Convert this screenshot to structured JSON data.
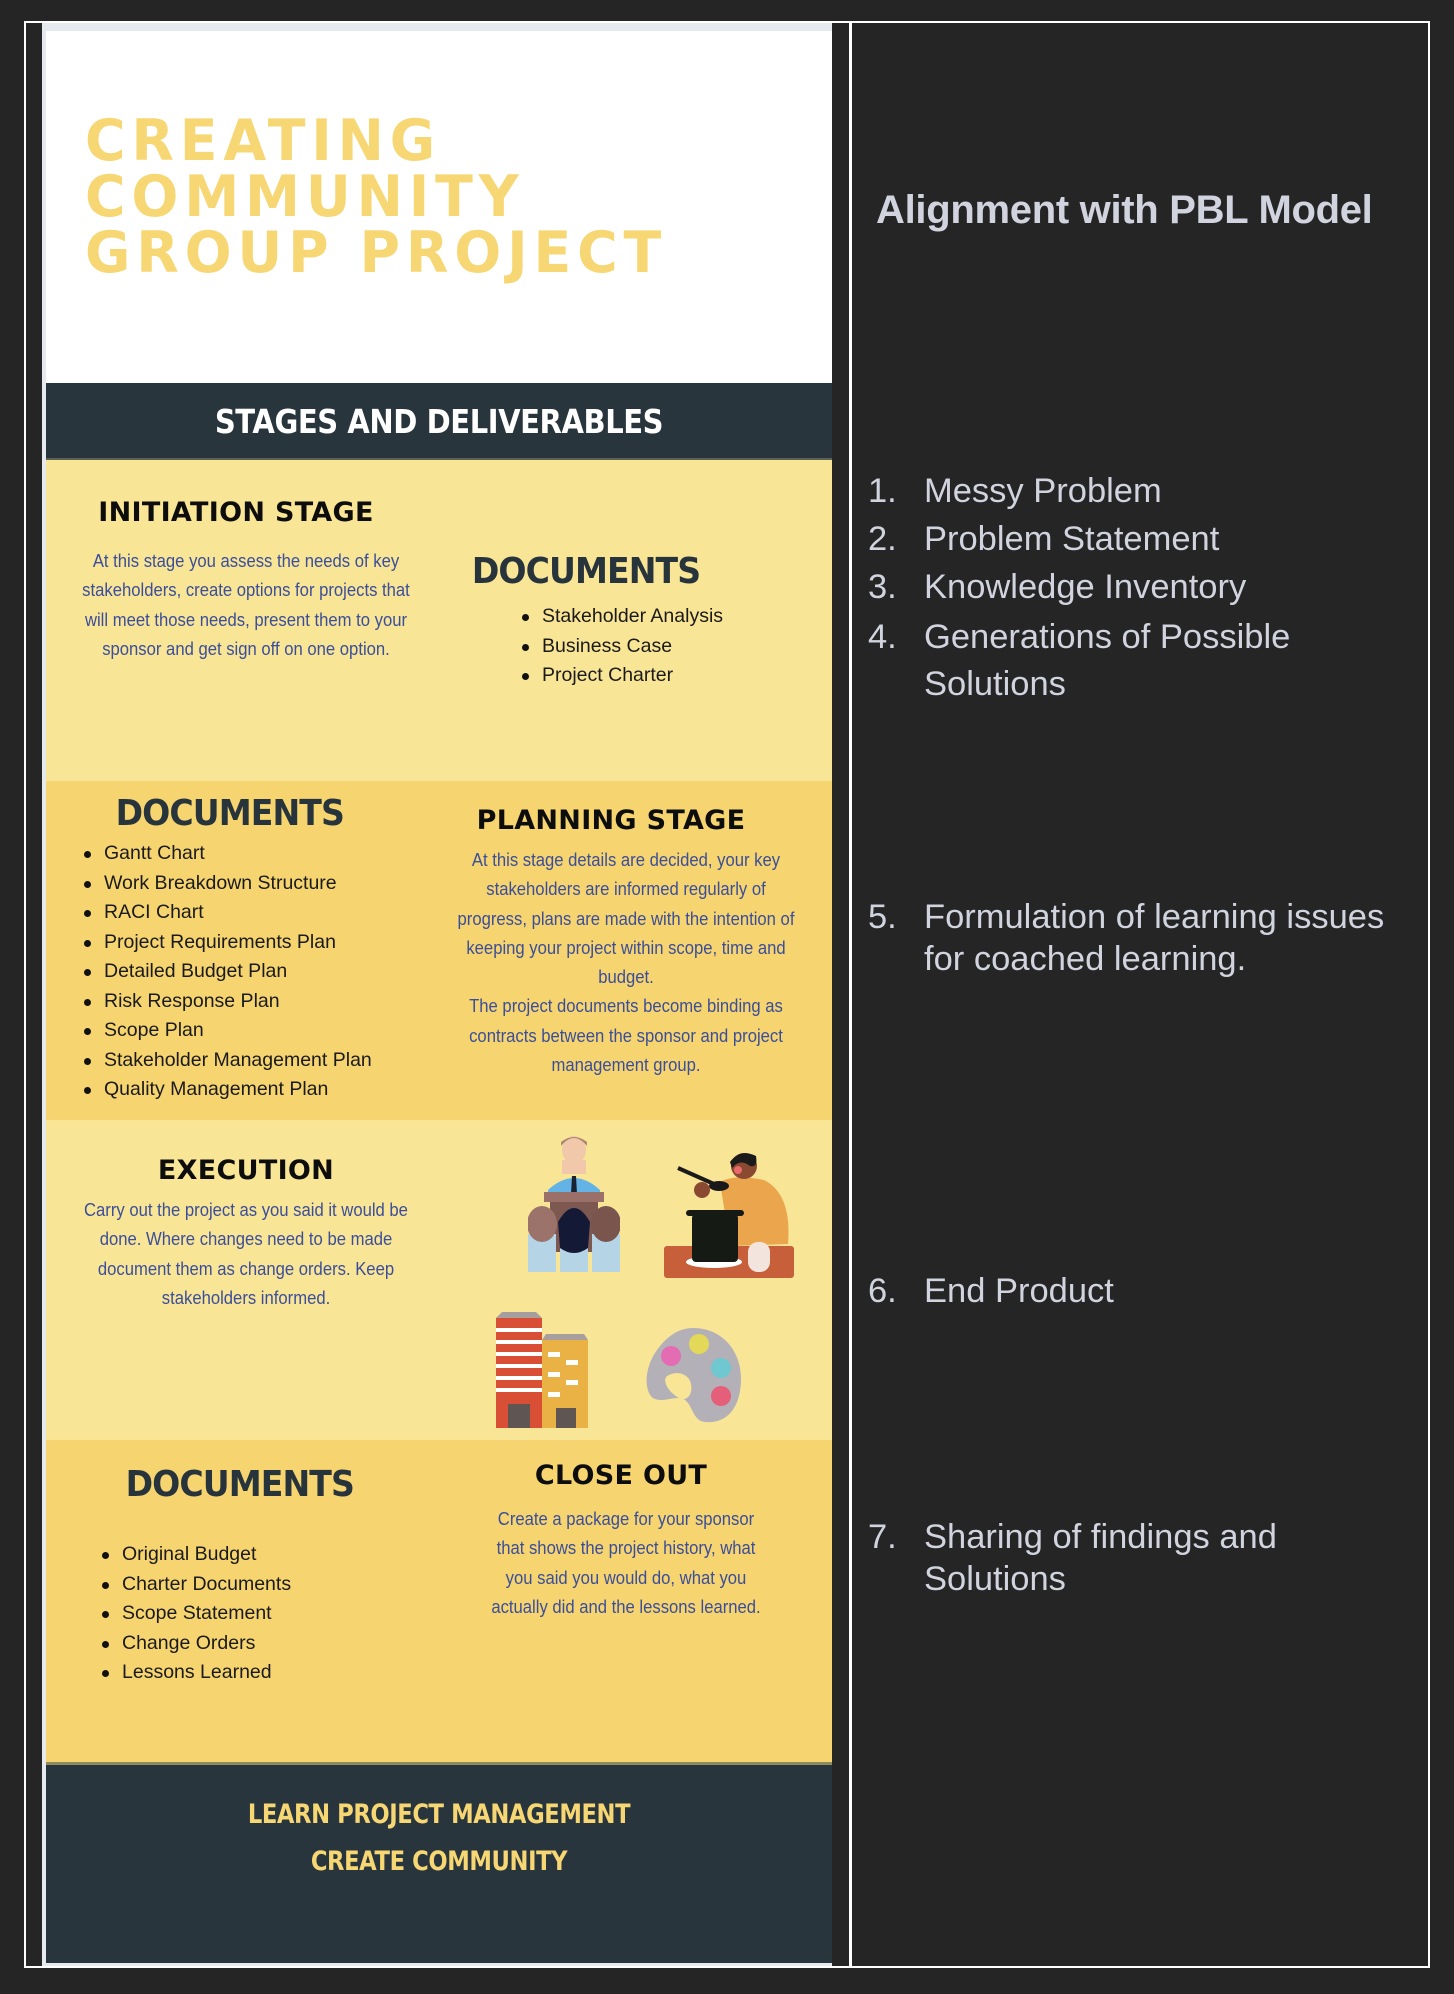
{
  "infographic": {
    "title_lines": [
      "CREATING",
      "COMMUNITY",
      "GROUP PROJECT"
    ],
    "stages_header": "STAGES AND DELIVERABLES",
    "initiation": {
      "title": "INITIATION STAGE",
      "description": "At this stage you assess the needs of key stakeholders, create options for projects that will meet those needs, present them to your sponsor and get sign off on one option.",
      "documents_title": "DOCUMENTS",
      "documents": [
        "Stakeholder Analysis",
        "Business Case",
        "Project Charter"
      ]
    },
    "planning": {
      "title": "PLANNING STAGE",
      "description": "At this stage details are decided, your key stakeholders are informed regularly of progress, plans are made with the intention of keeping your project within scope, time and budget.",
      "description_2": "The project documents become binding as contracts between the sponsor and project management group.",
      "documents_title": "DOCUMENTS",
      "documents": [
        "Gantt Chart",
        "Work Breakdown Structure",
        "RACI Chart",
        "Project Requirements Plan",
        "Detailed Budget Plan",
        "Risk Response Plan",
        "Scope Plan",
        "Stakeholder Management Plan",
        "Quality Management Plan"
      ]
    },
    "execution": {
      "title": "EXECUTION",
      "description": "Carry out the project as you said it would be done. Where changes need to be made document them as change orders. Keep stakeholders informed.",
      "illustrations": [
        "presenter-audience-illustration",
        "cooking-illustration",
        "buildings-illustration",
        "paint-palette-illustration"
      ]
    },
    "closeout": {
      "title": "CLOSE OUT",
      "description": "Create a package for your sponsor that shows the project history, what you said you would do, what you actually did and  the lessons learned.",
      "documents_title": "DOCUMENTS",
      "documents": [
        "Original Budget",
        "Charter Documents",
        "Scope Statement",
        "Change Orders",
        "Lessons Learned"
      ]
    },
    "footer_lines": [
      "LEARN PROJECT MANAGEMENT",
      "CREATE COMMUNITY"
    ],
    "colors": {
      "title_yellow": "#f7d774",
      "navy": "#29353c",
      "light_yellow": "#f9e596",
      "dark_yellow": "#f6d46f",
      "body_blue": "#3b4e9a"
    }
  },
  "pbl_panel": {
    "heading": "Alignment with PBL Model",
    "items": [
      {
        "num": "1.",
        "text": "Messy Problem"
      },
      {
        "num": "2.",
        "text": "Problem Statement"
      },
      {
        "num": "3.",
        "text": "Knowledge Inventory"
      },
      {
        "num": "4.",
        "text": "Generations of Possible Solutions"
      },
      {
        "num": "5.",
        "text": "Formulation of learning issues for coached learning."
      },
      {
        "num": "6.",
        "text": "End Product"
      },
      {
        "num": "7.",
        "text": "Sharing of findings and Solutions"
      }
    ],
    "colors": {
      "background": "#252525",
      "text": "#d1d3de"
    }
  }
}
